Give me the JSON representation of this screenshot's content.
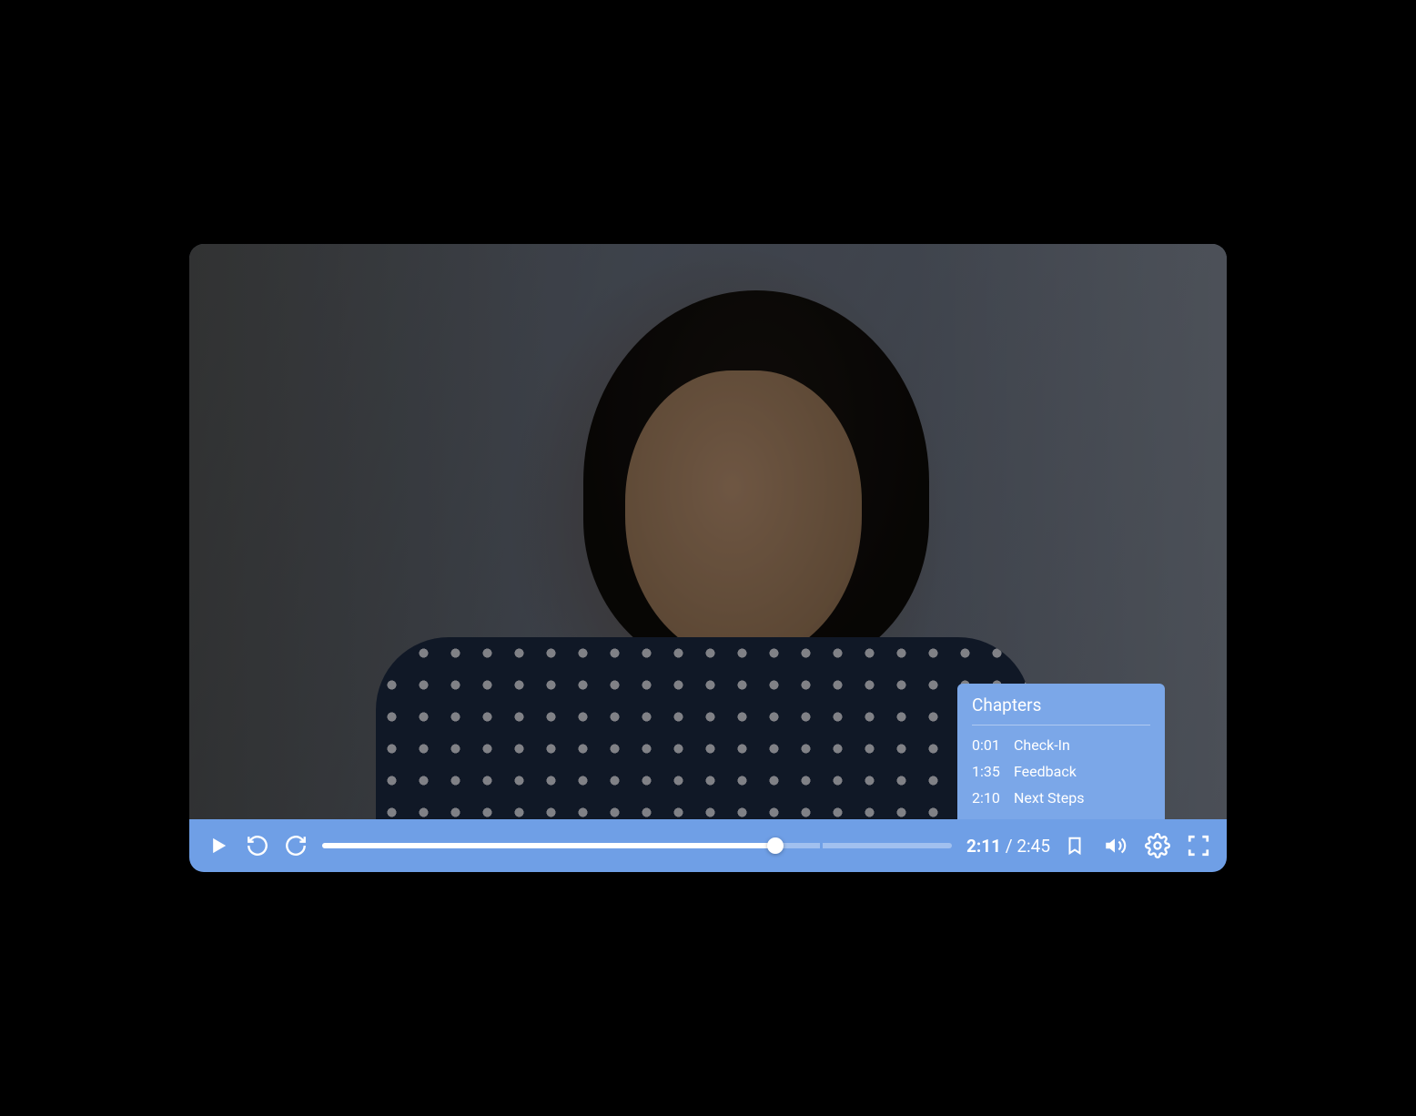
{
  "player": {
    "currentTime": "2:11",
    "duration": "2:45",
    "progressPercent": 72,
    "chapterMarks": [
      0.6,
      57.5,
      79.0
    ]
  },
  "chapters": {
    "title": "Chapters",
    "items": [
      {
        "time": "0:01",
        "label": "Check-In"
      },
      {
        "time": "1:35",
        "label": "Feedback"
      },
      {
        "time": "2:10",
        "label": "Next Steps"
      }
    ]
  },
  "colors": {
    "controlBar": "#6f9fe6",
    "popup": "#7ba7e8",
    "accent": "#ffffff"
  }
}
